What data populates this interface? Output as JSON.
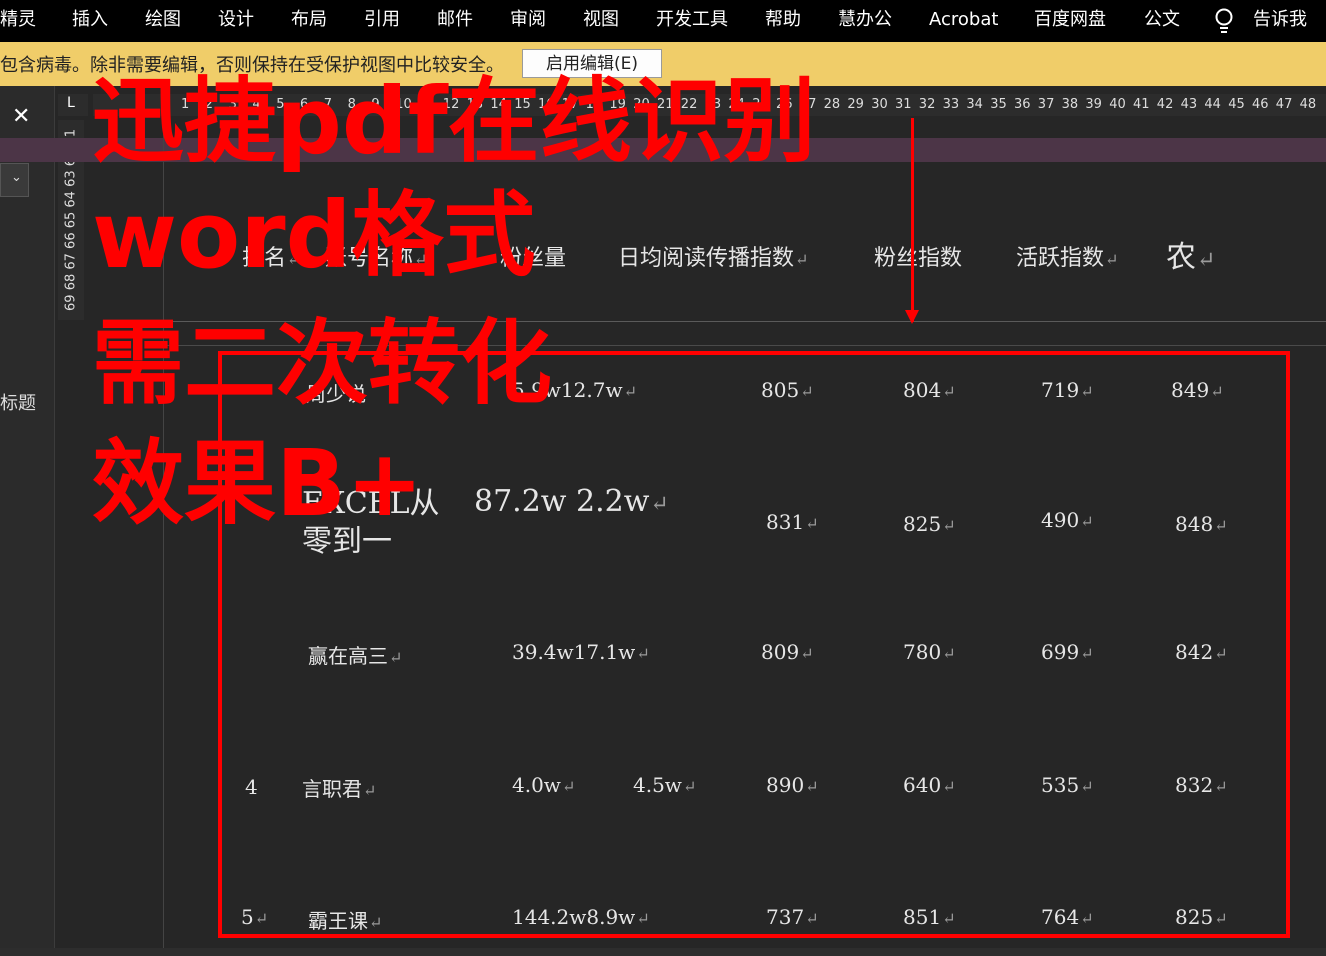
{
  "ribbon": {
    "tabs": [
      "精灵",
      "插入",
      "绘图",
      "设计",
      "布局",
      "引用",
      "邮件",
      "审阅",
      "视图",
      "开发工具",
      "帮助",
      "慧办公",
      "Acrobat",
      "百度网盘",
      "公文"
    ],
    "tell_me": "告诉我"
  },
  "protected_view": {
    "message": "包含病毒。除非需要编辑，否则保持在受保护视图中比较安全。",
    "enable_button": "启用编辑(E)"
  },
  "nav_pane": {
    "label": "标题"
  },
  "ruler": {
    "corner": "L",
    "h_ticks": [
      "1",
      "2",
      "3",
      "4",
      "5",
      "6",
      "7",
      "8",
      "9",
      "10",
      "11",
      "12",
      "13",
      "14",
      "15",
      "16",
      "17",
      "18",
      "19",
      "20",
      "21",
      "22",
      "23",
      "24",
      "25",
      "26",
      "27",
      "28",
      "29",
      "30",
      "31",
      "32",
      "33",
      "34",
      "35",
      "36",
      "37",
      "38",
      "39",
      "40",
      "41",
      "42",
      "43",
      "44",
      "45",
      "46",
      "47",
      "48"
    ],
    "v_text": "69 68 67 66 65 64 63 62 61"
  },
  "table": {
    "headers": [
      "排名",
      "账号名称",
      "粉丝量",
      "日均阅读传播指数",
      "粉丝指数",
      "活跃指数",
      "农"
    ],
    "rows": [
      [
        "",
        "周少说",
        "5.9w12.7w",
        "805",
        "804",
        "719",
        "849"
      ],
      [
        "",
        "EXCEL从零到一",
        "87.2w  2.2w",
        "831",
        "825",
        "490",
        "848"
      ],
      [
        "",
        "赢在高三",
        "39.4w17.1w",
        "809",
        "780",
        "699",
        "842"
      ],
      [
        "4",
        "言职君",
        "4.0w",
        "4.5w",
        "890",
        "640",
        "535",
        "832"
      ],
      [
        "5",
        "霸王课",
        "144.2w8.9w",
        "737",
        "851",
        "764",
        "825"
      ]
    ]
  },
  "overlay": {
    "line1": "迅捷pdf在线识别",
    "line2": "word格式",
    "line3": "需二次转化",
    "line4": "效果B+"
  },
  "colors": {
    "overlay_red": "#ff0000",
    "pv_bar": "#f0cd69",
    "band": "#4c3547"
  }
}
